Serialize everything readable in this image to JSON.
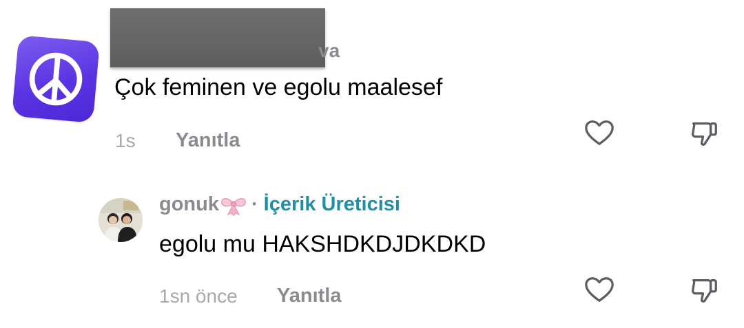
{
  "comments": [
    {
      "username_visible": "va",
      "text": "Çok feminen ve egolu maalesef",
      "time": "1s",
      "reply_label": "Yanıtla",
      "avatar_icon": "peace-sign-icon"
    },
    {
      "username": "gonuk",
      "username_emoji": "bow-icon",
      "separator": "·",
      "badge": "İçerik Üreticisi",
      "text": "egolu mu HAKSHDKDJDKDKD",
      "time": "1sn önce",
      "reply_label": "Yanıtla",
      "avatar_icon": "profile-photo"
    }
  ],
  "colors": {
    "text": "#000000",
    "muted": "#8a8b91",
    "time": "#a7a8ad",
    "badge": "#1f8fa6",
    "avatar_purple": "#5b34e2"
  }
}
